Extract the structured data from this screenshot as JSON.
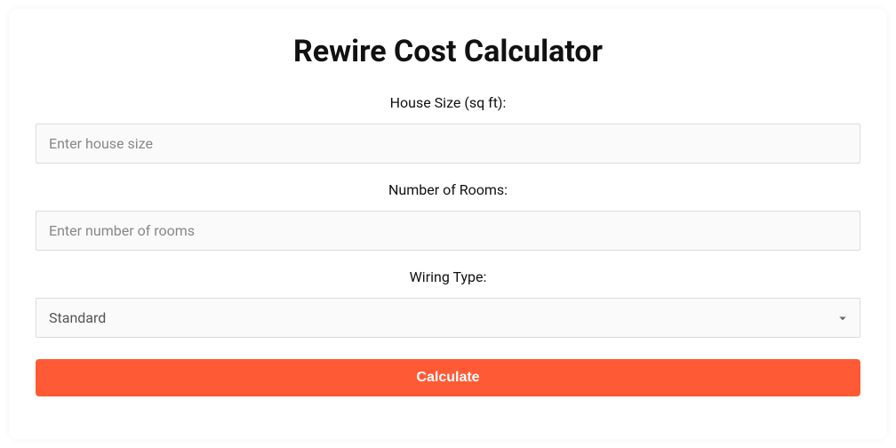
{
  "title": "Rewire Cost Calculator",
  "fields": {
    "houseSize": {
      "label": "House Size (sq ft):",
      "placeholder": "Enter house size",
      "value": ""
    },
    "numRooms": {
      "label": "Number of Rooms:",
      "placeholder": "Enter number of rooms",
      "value": ""
    },
    "wiringType": {
      "label": "Wiring Type:",
      "selected": "Standard"
    }
  },
  "button": {
    "label": "Calculate"
  },
  "colors": {
    "accent": "#ff5a36"
  }
}
